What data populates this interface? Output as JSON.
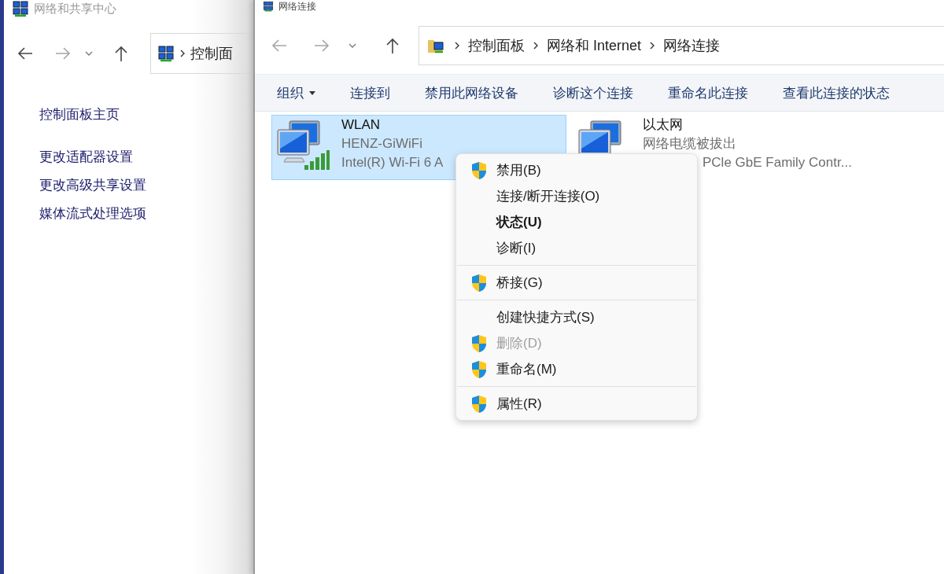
{
  "back_window": {
    "title": "网络和共享中心",
    "breadcrumb": [
      "控制面"
    ],
    "sidebar": {
      "items": [
        {
          "label": "控制面板主页",
          "kind": "home"
        },
        {
          "label": "更改适配器设置",
          "kind": "task"
        },
        {
          "label": "更改高级共享设置",
          "kind": "task"
        },
        {
          "label": "媒体流式处理选项",
          "kind": "task"
        }
      ]
    }
  },
  "window": {
    "title": "网络连接",
    "breadcrumb": [
      "控制面板",
      "网络和 Internet",
      "网络连接"
    ],
    "toolbar": [
      {
        "label": "组织",
        "dropdown": true
      },
      {
        "label": "连接到",
        "dropdown": false
      },
      {
        "label": "禁用此网络设备",
        "dropdown": false
      },
      {
        "label": "诊断这个连接",
        "dropdown": false
      },
      {
        "label": "重命名此连接",
        "dropdown": false
      },
      {
        "label": "查看此连接的状态",
        "dropdown": false
      }
    ],
    "connections": [
      {
        "name": "WLAN",
        "status": "HENZ-GiWiFi",
        "device": "Intel(R) Wi-Fi 6 A",
        "kind": "wireless",
        "selected": true
      },
      {
        "name": "以太网",
        "status": "网络电缆被拔出",
        "device": "PCle GbE Family Contr...",
        "kind": "wired",
        "selected": false
      }
    ]
  },
  "context_menu": {
    "groups": [
      [
        {
          "label": "禁用(B)",
          "shield": true,
          "default": false,
          "disabled": false
        },
        {
          "label": "连接/断开连接(O)",
          "shield": false,
          "default": false,
          "disabled": false
        },
        {
          "label": "状态(U)",
          "shield": false,
          "default": true,
          "disabled": false
        },
        {
          "label": "诊断(I)",
          "shield": false,
          "default": false,
          "disabled": false
        }
      ],
      [
        {
          "label": "桥接(G)",
          "shield": true,
          "default": false,
          "disabled": false
        }
      ],
      [
        {
          "label": "创建快捷方式(S)",
          "shield": false,
          "default": false,
          "disabled": false
        },
        {
          "label": "删除(D)",
          "shield": true,
          "default": false,
          "disabled": true
        },
        {
          "label": "重命名(M)",
          "shield": true,
          "default": false,
          "disabled": false
        }
      ],
      [
        {
          "label": "属性(R)",
          "shield": true,
          "default": false,
          "disabled": false
        }
      ]
    ]
  }
}
